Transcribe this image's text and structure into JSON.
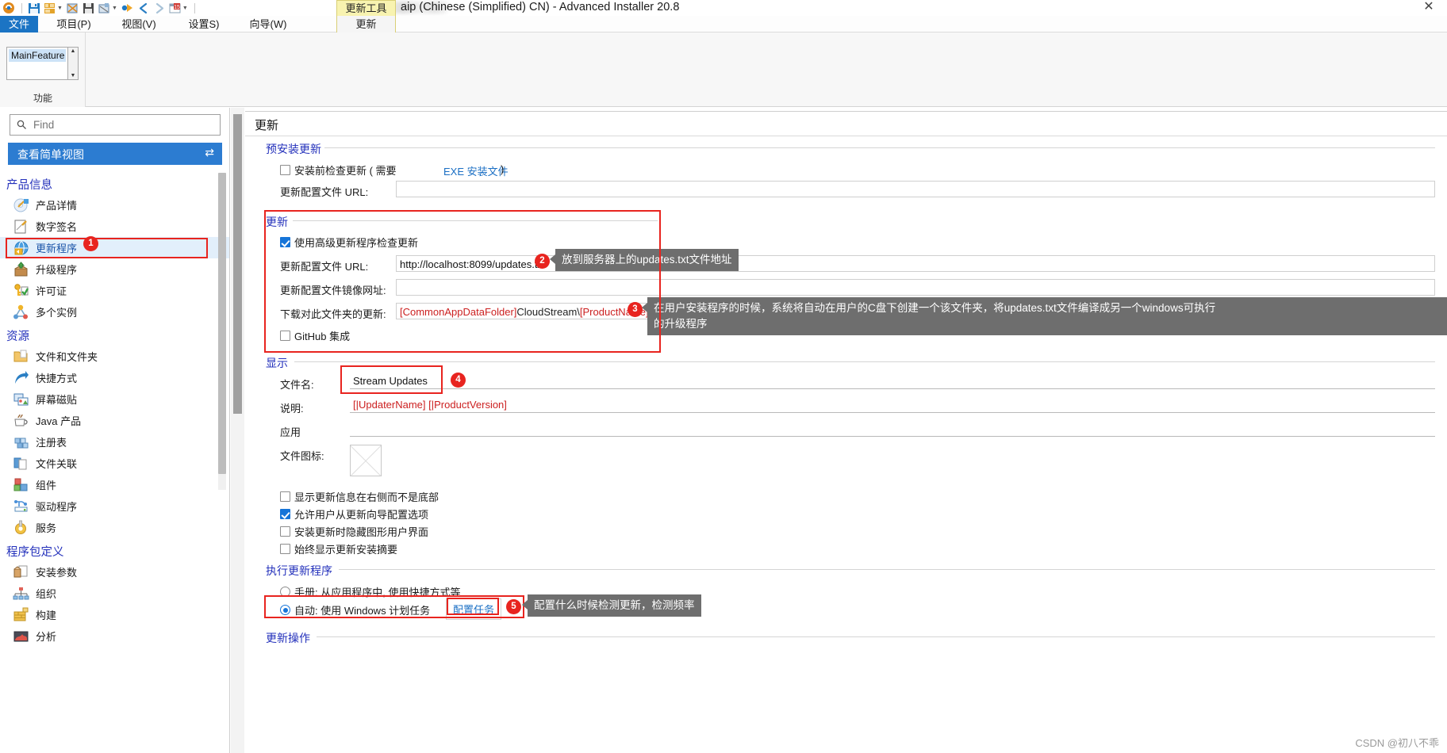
{
  "window": {
    "title_suffix": "aip (Chinese (Simplified) CN) - Advanced Installer 20.8",
    "close_glyph": "✕"
  },
  "quick_access": {
    "icons": [
      "new-project-icon",
      "save-icon",
      "save-as-icon",
      "build-icon",
      "build-save-icon",
      "build-run-icon",
      "run-icon",
      "back-icon",
      "forward-icon",
      "calendar-icon"
    ]
  },
  "menubar": {
    "items": [
      {
        "label": "文件",
        "name": "menu-file",
        "active": true
      },
      {
        "label": "项目(P)",
        "name": "menu-project",
        "active": false
      },
      {
        "label": "视图(V)",
        "name": "menu-view",
        "active": false
      },
      {
        "label": "设置S)",
        "name": "menu-settings",
        "active": false
      },
      {
        "label": "向导(W)",
        "name": "menu-wizard",
        "active": false
      }
    ],
    "contextual_tab_header": "更新工具",
    "contextual_tab": "更新"
  },
  "ribbon": {
    "group_label": "功能",
    "feature_selected": "MainFeature",
    "spin_up": "▲",
    "spin_down": "▼"
  },
  "sidebar": {
    "find_placeholder": "Find",
    "find_value": "",
    "simple_view_label": "查看简单视图",
    "simple_view_swap_glyph": "⇄",
    "groups": [
      {
        "title": "产品信息",
        "name": "sidebar-group-product-info",
        "items": [
          {
            "label": "产品详情",
            "icon": "product-details-icon",
            "name": "sidebar-item-product-details",
            "selected": false
          },
          {
            "label": "数字签名",
            "icon": "digital-signature-icon",
            "name": "sidebar-item-digital-signature",
            "selected": false
          },
          {
            "label": "更新程序",
            "icon": "updater-icon",
            "name": "sidebar-item-updater",
            "selected": true
          },
          {
            "label": "升级程序",
            "icon": "upgrades-icon",
            "name": "sidebar-item-upgrades",
            "selected": false
          },
          {
            "label": "许可证",
            "icon": "license-key-icon",
            "name": "sidebar-item-license",
            "selected": false
          },
          {
            "label": "多个实例",
            "icon": "multiple-instances-icon",
            "name": "sidebar-item-multiple-instances",
            "selected": false
          }
        ]
      },
      {
        "title": "资源",
        "name": "sidebar-group-resources",
        "items": [
          {
            "label": "文件和文件夹",
            "icon": "folder-icon",
            "name": "sidebar-item-files-folders",
            "selected": false
          },
          {
            "label": "快捷方式",
            "icon": "shortcut-icon",
            "name": "sidebar-item-shortcuts",
            "selected": false
          },
          {
            "label": "屏幕磁贴",
            "icon": "tiles-icon",
            "name": "sidebar-item-tiles",
            "selected": false
          },
          {
            "label": "Java 产品",
            "icon": "java-icon",
            "name": "sidebar-item-java-products",
            "selected": false
          },
          {
            "label": "注册表",
            "icon": "registry-icon",
            "name": "sidebar-item-registry",
            "selected": false
          },
          {
            "label": "文件关联",
            "icon": "file-association-icon",
            "name": "sidebar-item-file-associations",
            "selected": false
          },
          {
            "label": "组件",
            "icon": "components-icon",
            "name": "sidebar-item-components",
            "selected": false
          },
          {
            "label": "驱动程序",
            "icon": "drivers-icon",
            "name": "sidebar-item-drivers",
            "selected": false
          },
          {
            "label": "服务",
            "icon": "services-icon",
            "name": "sidebar-item-services",
            "selected": false
          }
        ]
      },
      {
        "title": "程序包定义",
        "name": "sidebar-group-package-definition",
        "items": [
          {
            "label": "安装参数",
            "icon": "install-parameters-icon",
            "name": "sidebar-item-install-parameters",
            "selected": false
          },
          {
            "label": "组织",
            "icon": "organization-icon",
            "name": "sidebar-item-organization",
            "selected": false
          },
          {
            "label": "构建",
            "icon": "builds-icon",
            "name": "sidebar-item-builds",
            "selected": false
          },
          {
            "label": "分析",
            "icon": "analytics-icon",
            "name": "sidebar-item-analytics",
            "selected": false
          }
        ]
      }
    ]
  },
  "page": {
    "title": "更新",
    "pre_install": {
      "group_title": "预安装更新",
      "checkbox_label_a": "安装前检查更新 ( 需要",
      "checkbox_checked": false,
      "exe_link": "EXE 安装文件",
      "checkbox_label_b": ")",
      "url_label": "更新配置文件 URL:",
      "url_value": ""
    },
    "update": {
      "group_title": "更新",
      "use_advanced_updater_label": "使用高级更新程序检查更新",
      "use_advanced_updater_checked": true,
      "url_label": "更新配置文件 URL:",
      "url_value": "http://localhost:8099/updates.txt",
      "mirror_label": "更新配置文件镜像网址:",
      "mirror_value": "",
      "download_folder_label": "下载对此文件夹的更新:",
      "download_folder_value_token1": "[CommonAppDataFolder]",
      "download_folder_value_mid": "CloudStream\\",
      "download_folder_value_token2": "[ProductName]",
      "download_folder_value_end": "\\updates\\",
      "github_label": "GitHub 集成",
      "github_checked": false
    },
    "display": {
      "group_title": "显示",
      "filename_label": "文件名:",
      "filename_value": "Stream Updates",
      "description_label": "说明:",
      "description_value": "[|UpdaterName] [|ProductVersion]",
      "application_label": "应用",
      "application_value": "",
      "file_icon_label": "文件图标:",
      "checkboxes": [
        {
          "label": "显示更新信息在右侧而不是底部",
          "checked": false,
          "name": "chk-show-info-right"
        },
        {
          "label": "允许用户从更新向导配置选项",
          "checked": true,
          "name": "chk-allow-user-configure"
        },
        {
          "label": "安装更新时隐藏图形用户界面",
          "checked": false,
          "name": "chk-hide-gui"
        },
        {
          "label": "始终显示更新安装摘要",
          "checked": false,
          "name": "chk-always-show-summary"
        }
      ]
    },
    "execute": {
      "group_title": "执行更新程序",
      "radio_manual": "手册: 从应用程序中, 使用快捷方式等",
      "radio_manual_selected": false,
      "radio_auto": "自动: 使用 Windows 计划任务",
      "radio_auto_selected": true,
      "configure_task_link": "配置任务"
    },
    "update_actions": {
      "group_title": "更新操作"
    }
  },
  "annotations": [
    {
      "num": "1",
      "tip": ""
    },
    {
      "num": "2",
      "tip": "放到服务器上的updates.txt文件地址"
    },
    {
      "num": "3",
      "tip": "在用户安装程序的时候，系统将自动在用户的C盘下创建一个该文件夹，将updates.txt文件编译成另一个windows可执行\n的升级程序"
    },
    {
      "num": "4",
      "tip": ""
    },
    {
      "num": "5",
      "tip": "配置什么时候检测更新，检测频率"
    }
  ],
  "watermark": "CSDN @初八不乖",
  "colors": {
    "accent_blue": "#2c7cd1",
    "group_title_blue": "#2330bb",
    "link_blue": "#1b6fc4",
    "annotation_red": "#e8241f",
    "tooltip_gray": "#6e6e6e",
    "token_red": "#cc2020"
  }
}
